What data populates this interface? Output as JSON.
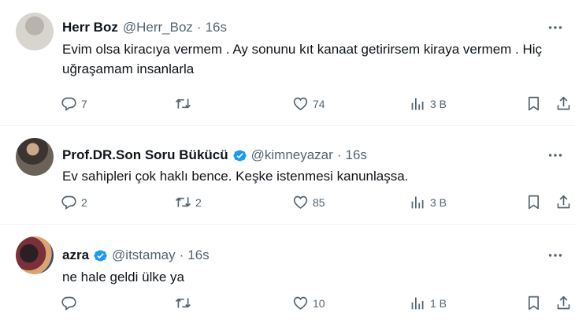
{
  "tweets": [
    {
      "name": "Herr Boz",
      "handle": "@Herr_Boz",
      "time": "16s",
      "verified": false,
      "text": "Evim olsa kiracıya vermem . Ay sonunu kıt kanaat getirirsem kiraya vermem . Hiç uğraşamam insanlarla",
      "replies": "7",
      "retweets": "",
      "likes": "74",
      "views": "3 B"
    },
    {
      "name": "Prof.DR.Son Soru Bükücü",
      "handle": "@kimneyazar",
      "time": "16s",
      "verified": true,
      "text": "Ev sahipleri çok haklı bence. Keşke istenmesi kanunlaşsa.",
      "replies": "2",
      "retweets": "2",
      "likes": "85",
      "views": "3 B"
    },
    {
      "name": "azra",
      "handle": "@itstamay",
      "time": "16s",
      "verified": true,
      "text": "ne hale geldi ülke ya",
      "replies": "",
      "retweets": "",
      "likes": "10",
      "views": "1 B"
    }
  ],
  "separator": "·",
  "colors": {
    "text": "#0f1419",
    "muted": "#536471",
    "verified": "#1d9bf0",
    "divider": "#eff3f4"
  },
  "icons": [
    "more-icon",
    "reply-icon",
    "retweet-icon",
    "like-icon",
    "views-icon",
    "bookmark-icon",
    "share-icon",
    "verified-badge-icon"
  ]
}
